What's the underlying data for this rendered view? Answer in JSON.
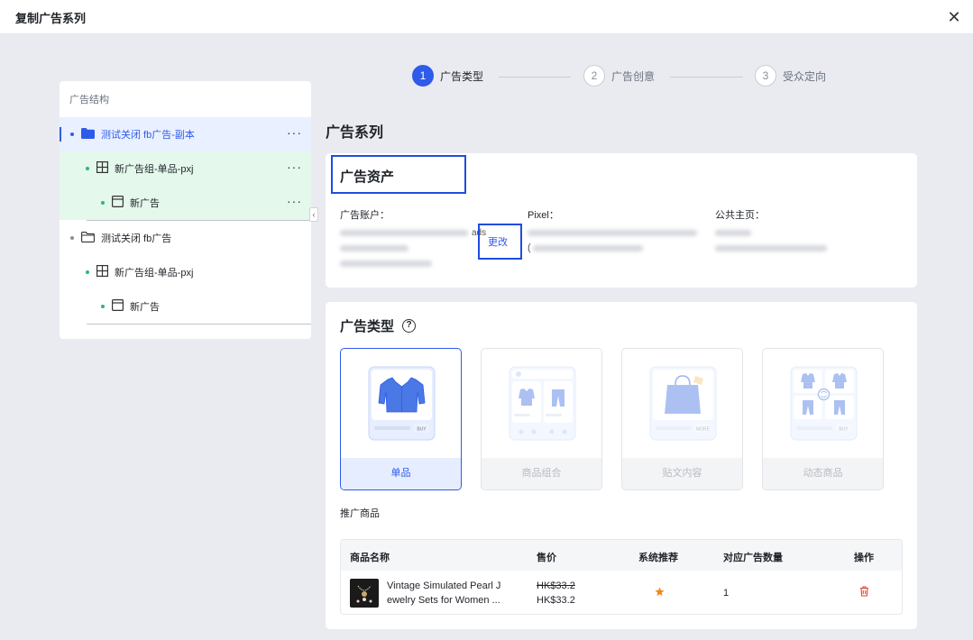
{
  "window": {
    "title": "复制广告系列"
  },
  "tree": {
    "header": "广告结构",
    "rows": [
      {
        "label": "测试关闭 fb广告-副本",
        "icon": "folder-filled-icon",
        "more": "···"
      },
      {
        "label": "新广告组-单品-pxj",
        "icon": "grid-icon",
        "more": "···"
      },
      {
        "label": "新广告",
        "icon": "window-icon",
        "more": "···"
      },
      {
        "label": "测试关闭 fb广告",
        "icon": "folder-outline-icon"
      },
      {
        "label": "新广告组-单品-pxj",
        "icon": "grid-icon"
      },
      {
        "label": "新广告",
        "icon": "window-icon"
      }
    ]
  },
  "steps": [
    {
      "num": "1",
      "label": "广告类型",
      "active": true
    },
    {
      "num": "2",
      "label": "广告创意"
    },
    {
      "num": "3",
      "label": "受众定向"
    }
  ],
  "section_title": "广告系列",
  "assets": {
    "title": "广告资产",
    "account_label": "广告账户：",
    "account_suffix": "ads",
    "change_label": "更改",
    "pixel_label": "Pixel：",
    "pixel_open_paren": "(",
    "page_label": "公共主页："
  },
  "ad_type": {
    "title": "广告类型",
    "help_icon": "?",
    "options": [
      {
        "label": "单品",
        "selected": true
      },
      {
        "label": "商品组合"
      },
      {
        "label": "贴文内容"
      },
      {
        "label": "动态商品"
      }
    ],
    "buy_text": "BUY",
    "more_text": "MORE"
  },
  "promo": {
    "label": "推广商品",
    "columns": [
      "商品名称",
      "售价",
      "系统推荐",
      "对应广告数量",
      "操作"
    ],
    "row": {
      "name_line1": "Vintage Simulated Pearl J",
      "name_line2": "ewelry Sets for Women ...",
      "original_price": "HK$33.2",
      "price": "HK$33.2",
      "count": "1"
    }
  },
  "colors": {
    "accent": "#2f5bea",
    "highlight": "#1f4de0",
    "green_dot": "#2eb872",
    "danger": "#e5412f",
    "star": "#f08a1c"
  }
}
